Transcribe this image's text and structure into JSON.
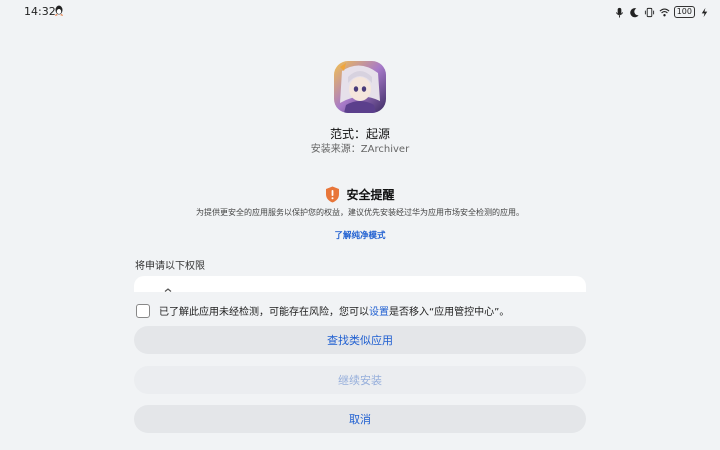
{
  "status_bar": {
    "time": "14:32",
    "battery": "100",
    "icons": [
      "qq-icon",
      "mic-icon",
      "moon-icon",
      "vibrate-icon",
      "wifi-icon",
      "battery-icon",
      "charging-icon"
    ]
  },
  "app": {
    "name": "范式：起源",
    "source_prefix": "安装来源：",
    "source_value": "ZArchiver",
    "icon": "app-icon"
  },
  "security": {
    "title": "安全提醒",
    "description": "为提供更安全的应用服务以保护您的权益，建议优先安装经过华为应用市场安全检测的应用。",
    "link": "了解纯净模式",
    "icon": "warning-shield-icon",
    "accent": "#e8763a"
  },
  "permissions": {
    "label": "将申请以下权限"
  },
  "consent": {
    "text_before": "已了解此应用未经检测，可能存在风险，您可以",
    "link": "设置",
    "text_after": "是否移入“应用管控中心”。",
    "checked": false
  },
  "buttons": {
    "find_similar": "查找类似应用",
    "continue_install": "继续安装",
    "cancel": "取消"
  },
  "colors": {
    "background": "#f1f3f5",
    "link": "#1f5fd1",
    "button_bg": "#e4e6e9"
  }
}
